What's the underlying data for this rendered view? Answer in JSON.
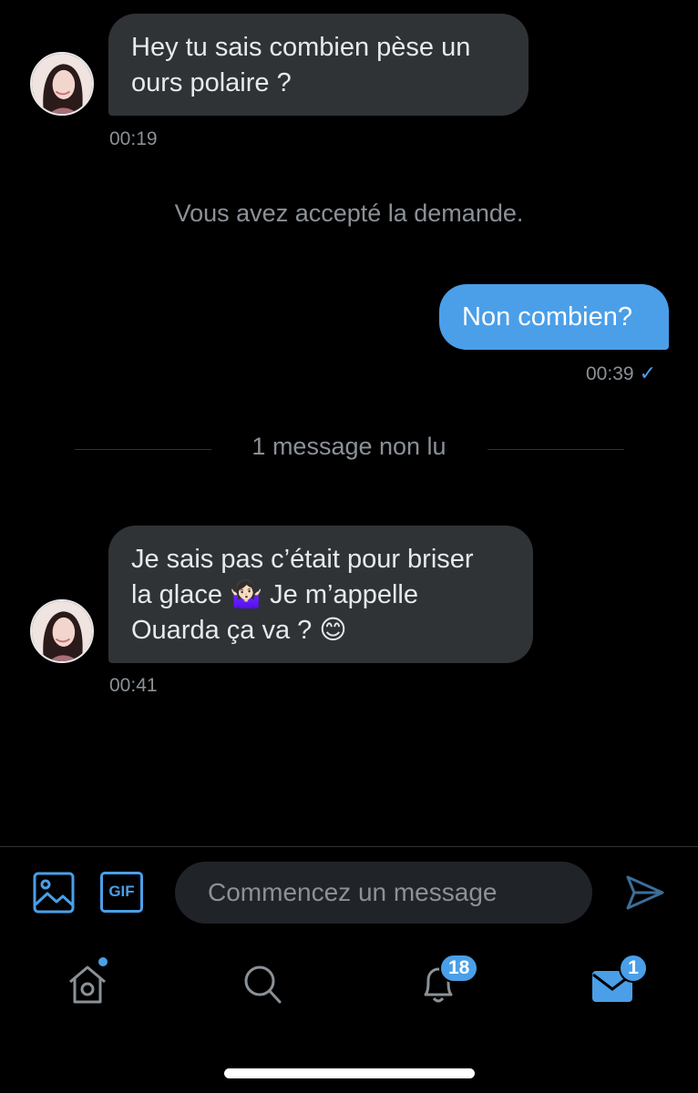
{
  "messages": [
    {
      "direction": "in",
      "text_lines": [
        "Hey tu sais combien pèse un",
        "ours polaire ?"
      ],
      "time": "00:19"
    },
    {
      "system": "Vous avez accepté la demande."
    },
    {
      "direction": "out",
      "text": "Non combien?",
      "time": "00:39",
      "status_icon": "check-icon"
    },
    {
      "divider": "1 message non lu"
    },
    {
      "direction": "in",
      "text_lines": [
        "Je sais pas c’était pour briser",
        "la glace 🤷🏻‍♀️ Je m’appelle",
        "Ouarda ça va ? 😊"
      ],
      "time": "00:41"
    }
  ],
  "composer": {
    "placeholder": "Commencez un message",
    "image_icon": "image-icon",
    "gif_label": "GIF",
    "send_icon": "send-icon"
  },
  "nav": {
    "home": {
      "icon": "home-icon",
      "has_dot": true
    },
    "search": {
      "icon": "search-icon"
    },
    "notifications": {
      "icon": "bell-icon",
      "badge": "18"
    },
    "messages": {
      "icon": "mail-icon",
      "badge": "1",
      "active": true
    }
  },
  "colors": {
    "accent": "#4a9fe8",
    "background": "#000000",
    "bubble_in": "#2f3336",
    "muted": "#8b9197"
  }
}
